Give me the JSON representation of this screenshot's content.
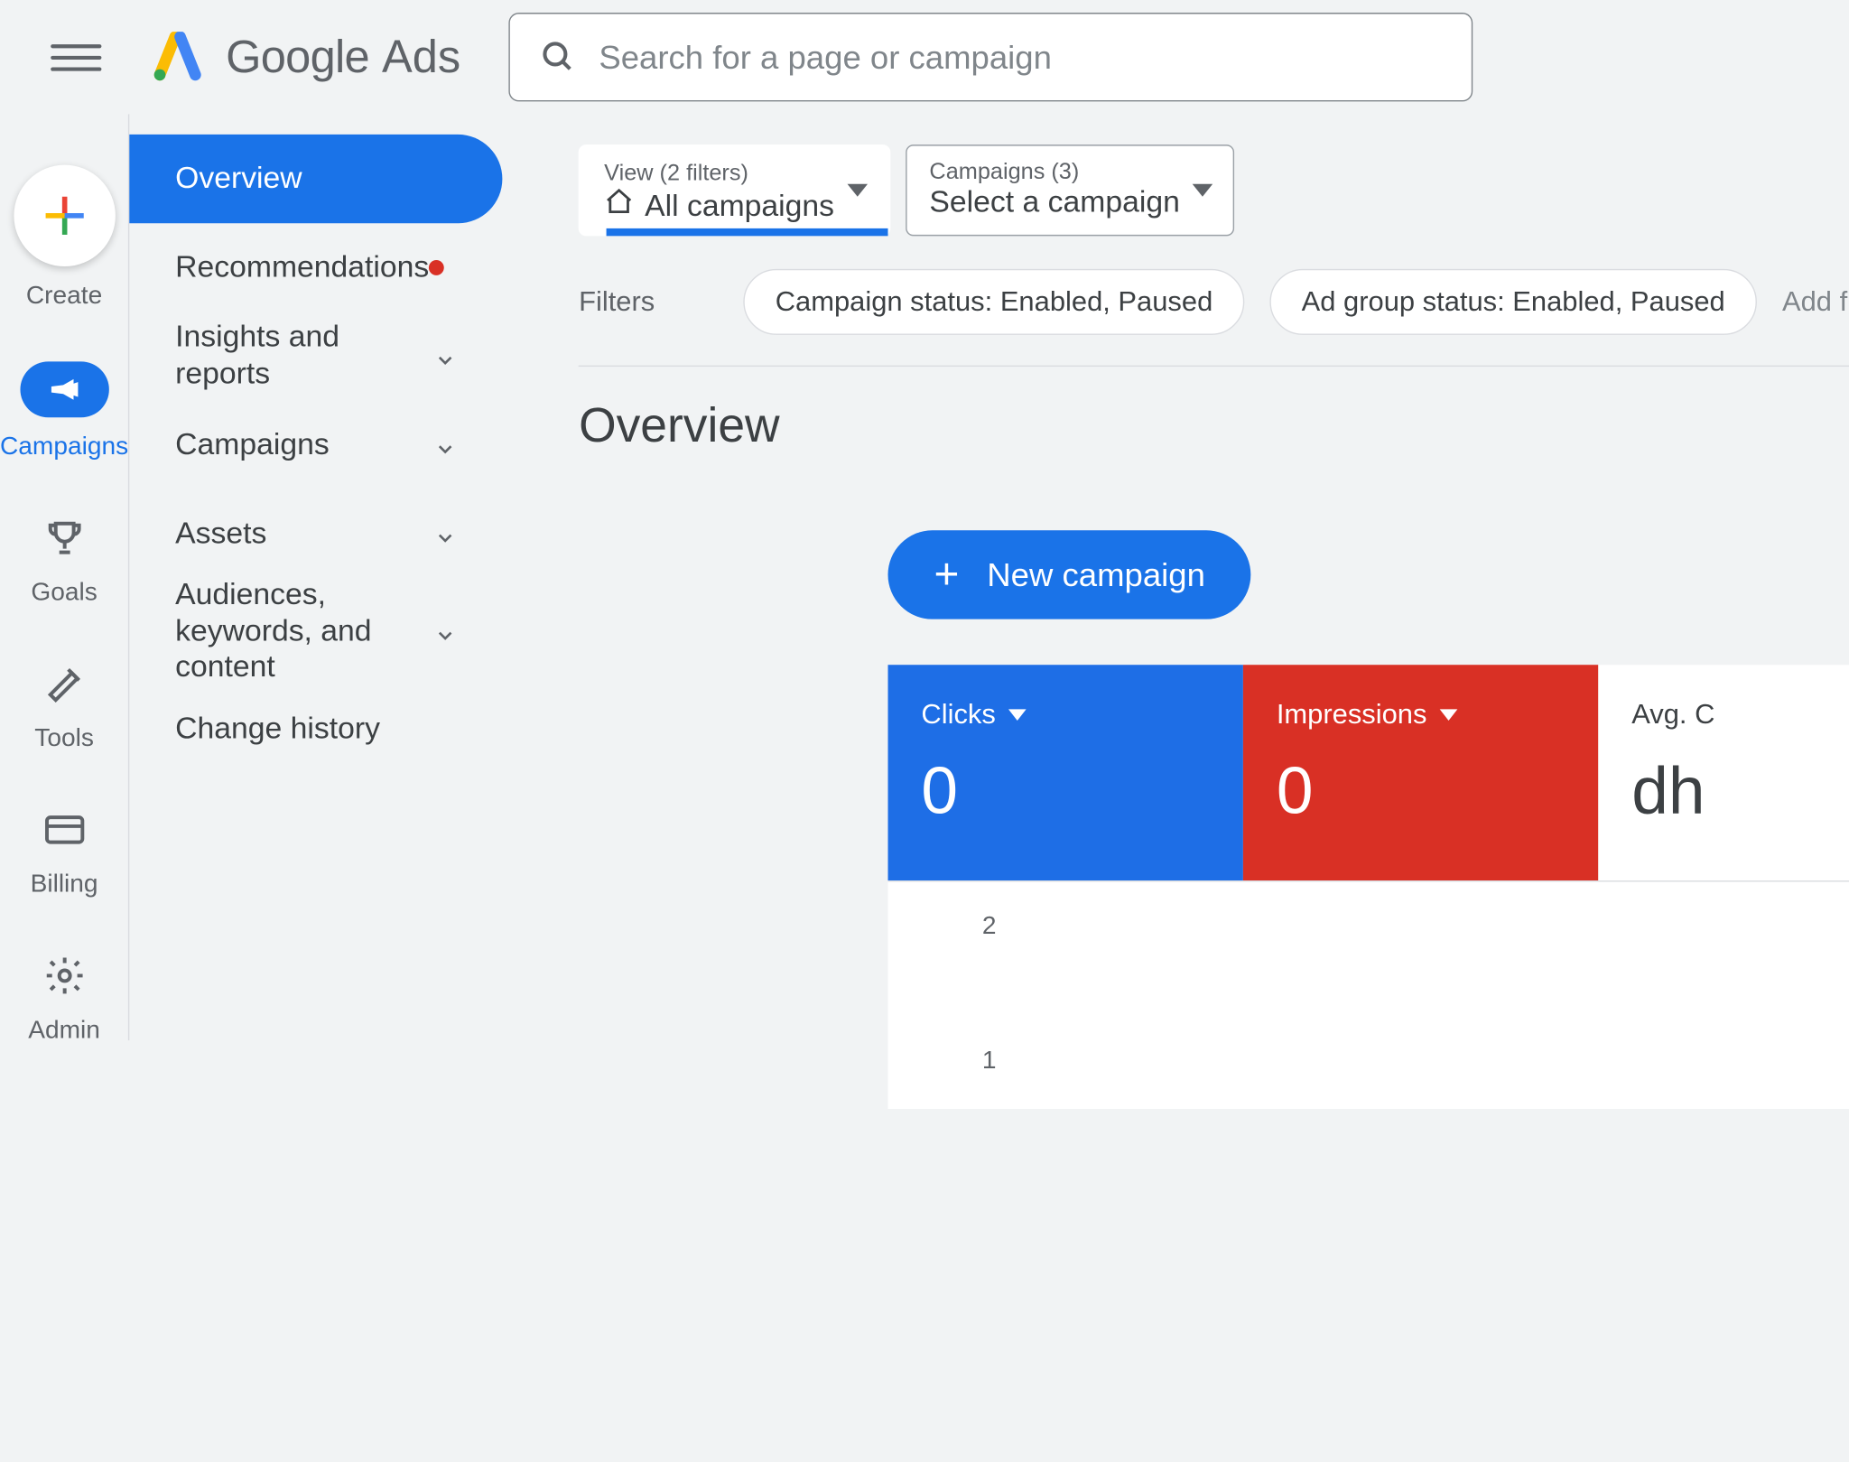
{
  "brand": {
    "google": "Google",
    "ads": "Ads"
  },
  "search": {
    "placeholder": "Search for a page or campaign"
  },
  "rail": {
    "create": "Create",
    "campaigns": "Campaigns",
    "goals": "Goals",
    "tools": "Tools",
    "billing": "Billing",
    "admin": "Admin"
  },
  "sidebar": {
    "overview": "Overview",
    "recommendations": "Recommendations",
    "insights": "Insights and reports",
    "campaigns": "Campaigns",
    "assets": "Assets",
    "audiences": "Audiences, keywords, and content",
    "change_history": "Change history"
  },
  "selectors": {
    "view_label": "View (2 filters)",
    "view_value": "All campaigns",
    "campaigns_label": "Campaigns (3)",
    "campaigns_value": "Select a campaign"
  },
  "filters": {
    "label": "Filters",
    "chip1": "Campaign status: Enabled, Paused",
    "chip2": "Ad group status: Enabled, Paused",
    "add": "Add filter"
  },
  "page_title": "Overview",
  "new_campaign": "New campaign",
  "stats": {
    "clicks_label": "Clicks",
    "clicks_value": "0",
    "impressions_label": "Impressions",
    "impressions_value": "0",
    "avg_label": "Avg. C",
    "avg_value": "dh"
  },
  "colors": {
    "primary": "#1a73e8",
    "danger": "#d93025"
  },
  "chart_data": {
    "type": "line",
    "title": "",
    "xlabel": "",
    "ylabel": "",
    "ylim": [
      0,
      2
    ],
    "y_ticks": [
      "2",
      "1"
    ],
    "series": [
      {
        "name": "Clicks",
        "values": []
      },
      {
        "name": "Impressions",
        "values": []
      }
    ]
  }
}
